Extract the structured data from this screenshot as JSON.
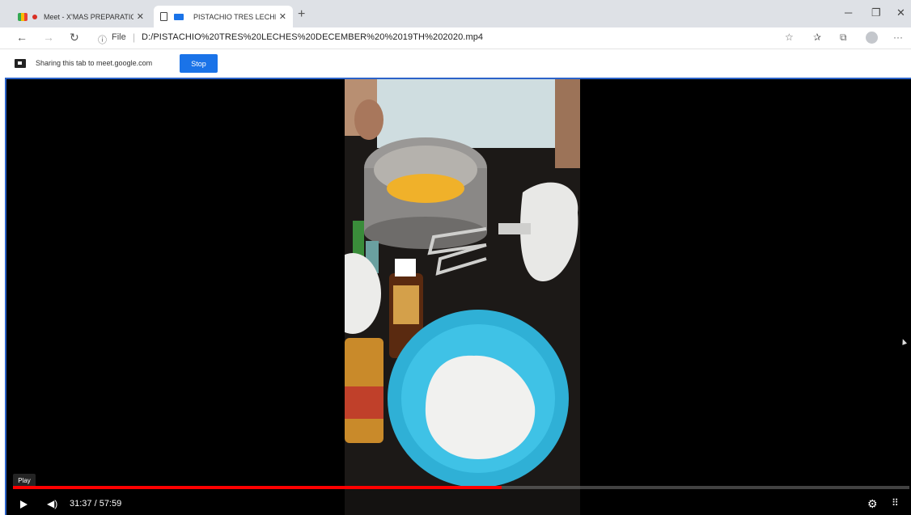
{
  "tabs": [
    {
      "title": "Meet - X'MAS PREPARATIO",
      "active": false,
      "recording": true
    },
    {
      "title": "PISTACHIO TRES LECHES D",
      "active": true,
      "casting": true
    }
  ],
  "address_bar": {
    "scheme_label": "File",
    "url": "D:/PISTACHIO%20TRES%20LECHES%20DECEMBER%20%2019TH%202020.mp4"
  },
  "sharing_bar": {
    "message": "Sharing this tab to meet.google.com",
    "stop_label": "Stop"
  },
  "player": {
    "tooltip": "Play",
    "time_display": "31:37 / 57:59",
    "progress_fraction": 0.545
  },
  "colors": {
    "accent": "#1a73e8",
    "progress": "#ff0000",
    "video_border": "#2b62c9"
  },
  "icons": {
    "back": "arrow-left-icon",
    "forward": "arrow-right-icon",
    "reload": "reload-icon",
    "play": "play-icon",
    "volume": "volume-icon",
    "settings": "gear-icon",
    "fullscreen": "exit-fullscreen-icon"
  }
}
